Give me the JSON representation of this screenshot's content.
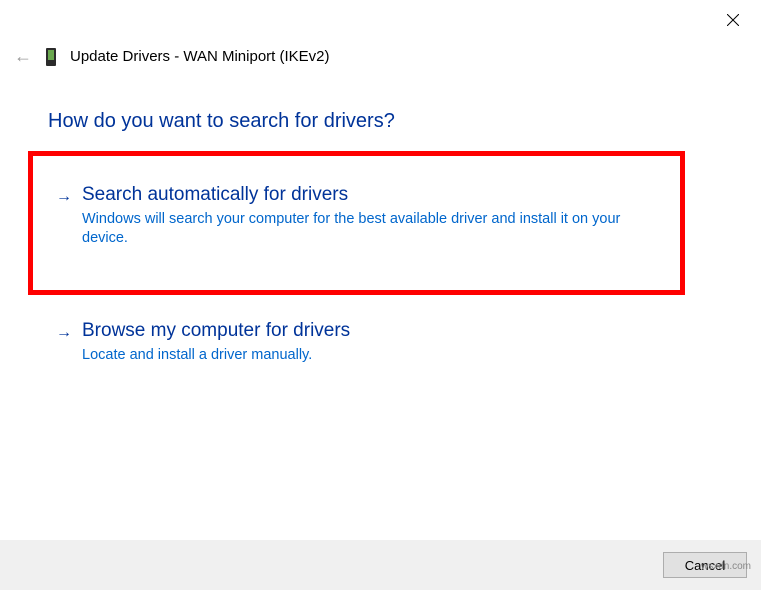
{
  "window": {
    "title": "Update Drivers - WAN Miniport (IKEv2)"
  },
  "question": "How do you want to search for drivers?",
  "options": {
    "auto": {
      "title": "Search automatically for drivers",
      "description": "Windows will search your computer for the best available driver and install it on your device."
    },
    "browse": {
      "title": "Browse my computer for drivers",
      "description": "Locate and install a driver manually."
    }
  },
  "footer": {
    "cancel_label": "Cancel"
  },
  "watermark": "wsxdn.com"
}
